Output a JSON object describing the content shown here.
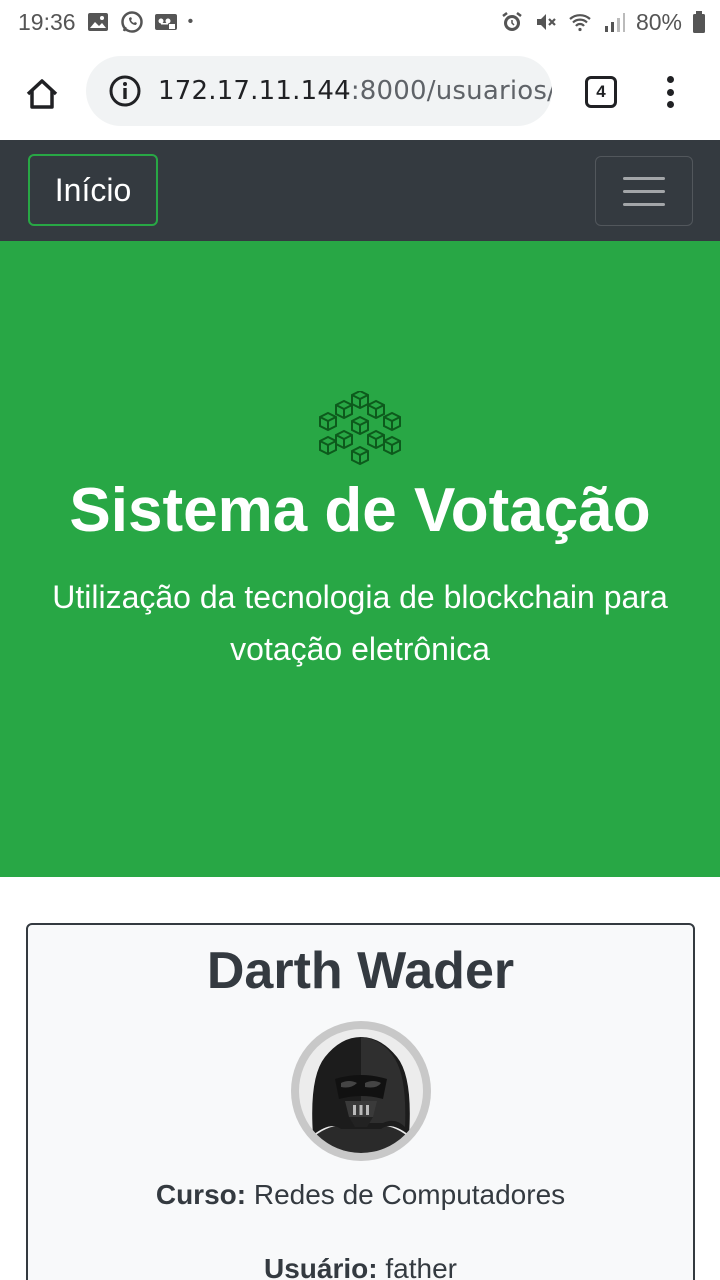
{
  "status_bar": {
    "time": "19:36",
    "dot": "•",
    "battery": "80%",
    "left_icons": [
      "image-icon",
      "whatsapp-icon",
      "voicemail-icon"
    ],
    "right_icons": [
      "alarm-icon",
      "mute-icon",
      "wifi-icon",
      "signal-icon",
      "battery-icon"
    ]
  },
  "browser": {
    "url_host": "172.17.11.144",
    "url_rest": ":8000/usuarios/",
    "tab_count": "4"
  },
  "navbar": {
    "brand": "Início"
  },
  "hero": {
    "title": "Sistema de Votação",
    "subtitle": "Utilização da tecnologia de blockchain para votação eletrônica"
  },
  "profile": {
    "name": "Darth Wader",
    "curso_label": "Curso:",
    "curso_value": "Redes de Computadores",
    "usuario_label": "Usuário:",
    "usuario_value": "father"
  },
  "colors": {
    "green": "#28a745",
    "dark": "#343a40",
    "card_bg": "#f8f9fa"
  }
}
